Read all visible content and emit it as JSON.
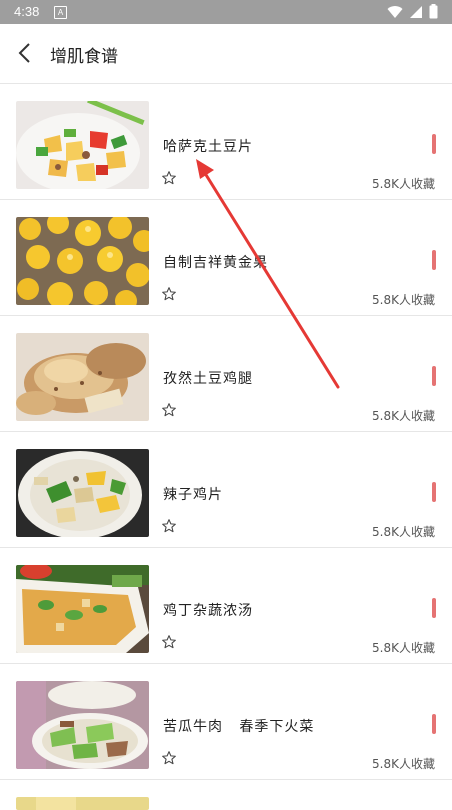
{
  "status": {
    "time": "4:38",
    "notif_letter": "A"
  },
  "header": {
    "title": "增肌食谱"
  },
  "recipes": [
    {
      "name": "哈萨克土豆片",
      "favorites": "5.8K人收藏"
    },
    {
      "name": "自制吉祥黄金果",
      "favorites": "5.8K人收藏"
    },
    {
      "name": "孜然土豆鸡腿",
      "favorites": "5.8K人收藏"
    },
    {
      "name": "辣子鸡片",
      "favorites": "5.8K人收藏"
    },
    {
      "name": "鸡丁杂蔬浓汤",
      "favorites": "5.8K人收藏"
    },
    {
      "name": "苦瓜牛肉   春季下火菜",
      "favorites": "5.8K人收藏"
    }
  ],
  "colors": {
    "accent": "#e57373",
    "annotation_arrow": "#e53935"
  }
}
